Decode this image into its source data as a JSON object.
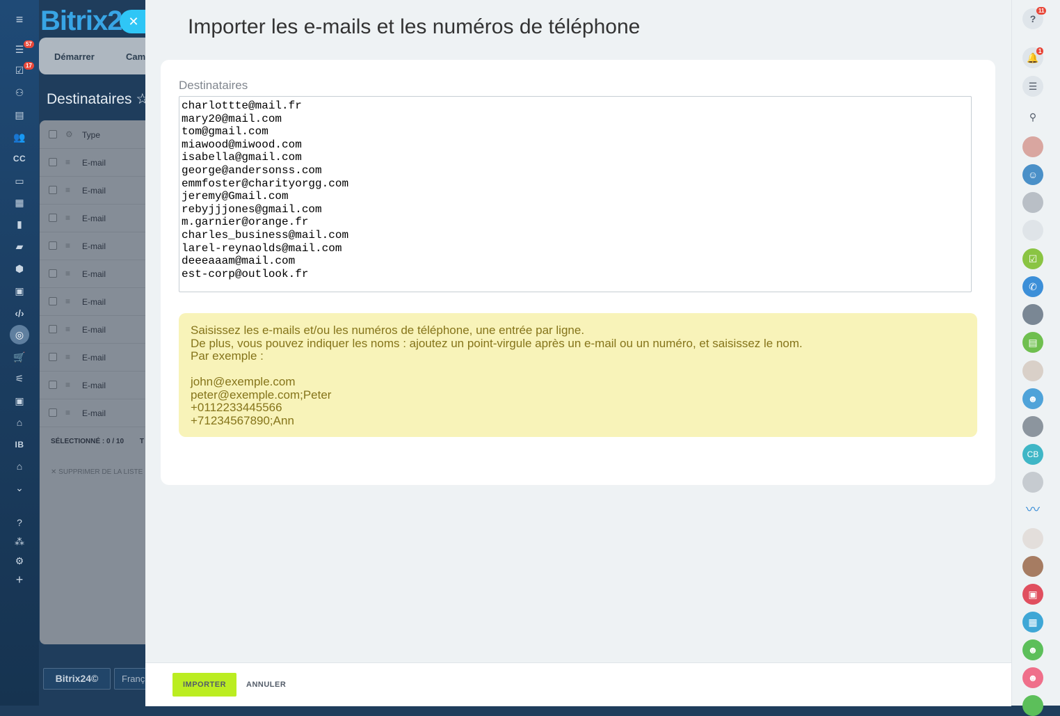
{
  "left_nav": {
    "badges": [
      "57",
      "17"
    ],
    "labels": {
      "cc": "CC",
      "ib": "IB"
    }
  },
  "background_page": {
    "logo": "Bitrix2",
    "tabs": [
      "Démarrer",
      "Cam"
    ],
    "title": "Destinataires",
    "table": {
      "header": "Type",
      "rows": [
        "E-mail",
        "E-mail",
        "E-mail",
        "E-mail",
        "E-mail",
        "E-mail",
        "E-mail",
        "E-mail",
        "E-mail",
        "E-mail"
      ],
      "selected_label": "SÉLECTIONNÉ :",
      "selected_value": "0 / 10",
      "selected_extra": "T",
      "remove_label": "SUPPRIMER DE LA LISTE"
    },
    "footer": {
      "logo": "Bitrix24",
      "lang": "Franç"
    }
  },
  "slider": {
    "title": "Importer les e-mails et les numéros de téléphone",
    "recipients_label": "Destinataires",
    "recipients_value": "charlottte@mail.fr\nmary20@mail.com\ntom@gmail.com\nmiawood@miwood.com\nisabella@gmail.com\ngeorge@andersonss.com\nemmfoster@charityorgg.com\njeremy@Gmail.com\nrebyjjjones@gmail.com\nm.garnier@orange.fr\ncharles_business@mail.com\nlarel-reynaolds@mail.com\ndeeeaaam@mail.com\nest-corp@outlook.fr",
    "hint": {
      "line1": "Saisissez les e-mails et/ou les numéros de téléphone, une entrée par ligne.",
      "line2": "De plus, vous pouvez indiquer les noms : ajoutez un point-virgule après un e-mail ou un numéro, et saisissez le nom.",
      "line3": "Par exemple :",
      "examples": [
        "john@exemple.com",
        "peter@exemple.com;Peter",
        "+0112233445566",
        "+71234567890;Ann"
      ]
    },
    "import_label": "IMPORTER",
    "cancel_label": "ANNULER"
  },
  "right_bar": {
    "help_badge": "11",
    "notifications_badge": "1",
    "avatar_initials": "CB"
  },
  "colors": {
    "accent_blue": "#2fc6f6",
    "import_green": "#bbed21",
    "hint_bg": "#f8f3b9",
    "hint_text": "#85741a",
    "badge_red": "#e8483a"
  }
}
